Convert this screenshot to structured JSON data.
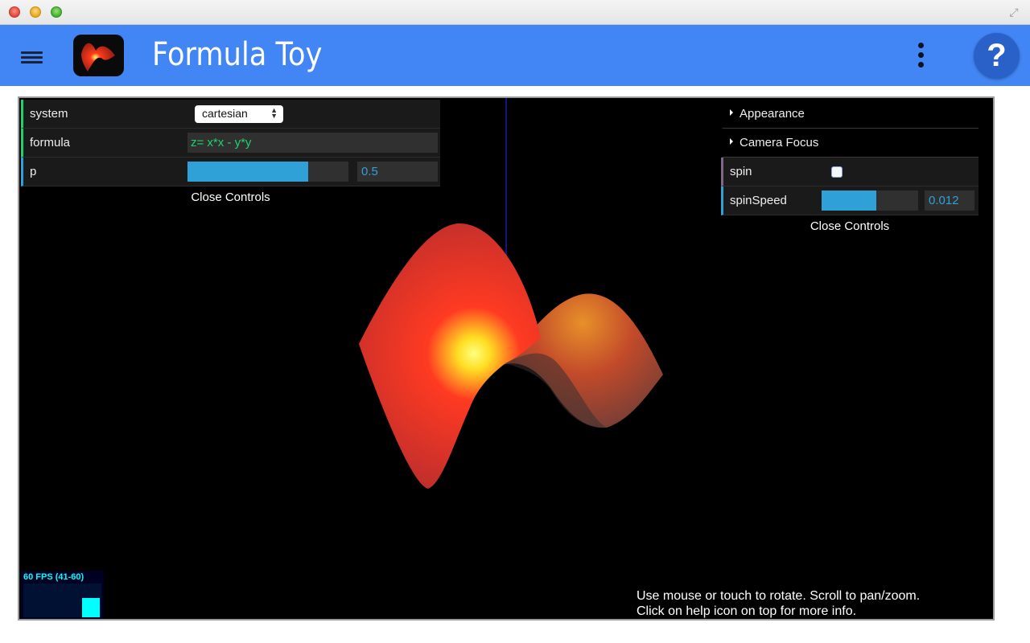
{
  "app": {
    "title": "Formula Toy"
  },
  "colors": {
    "appbar": "#4285f4",
    "help_button": "#2a61c8",
    "gui_string_accent": "#1ed36f",
    "gui_number_accent": "#2fa1d6",
    "gui_bool_accent": "#806787"
  },
  "icons": {
    "menu": "hamburger-menu-icon",
    "more": "more-vertical-icon",
    "help": "help-icon",
    "fullscreen": "fullscreen-icon"
  },
  "help": {
    "glyph": "?"
  },
  "gui_left": {
    "system": {
      "label": "system",
      "value": "cartesian"
    },
    "formula": {
      "label": "formula",
      "value": "z= x*x - y*y"
    },
    "p": {
      "label": "p",
      "value": "0.5",
      "fraction": 0.75
    },
    "close_label": "Close Controls"
  },
  "gui_right": {
    "appearance": {
      "label": "Appearance"
    },
    "camera_focus": {
      "label": "Camera Focus"
    },
    "spin": {
      "label": "spin",
      "checked": false
    },
    "spin_speed": {
      "label": "spinSpeed",
      "value": "0.012",
      "fraction": 0.57
    },
    "close_label": "Close Controls"
  },
  "stats": {
    "fps_text": "60 FPS (41-60)"
  },
  "hint": {
    "line1": "Use mouse or touch to rotate. Scroll to pan/zoom.",
    "line2": "Click on help icon on top for more info."
  }
}
